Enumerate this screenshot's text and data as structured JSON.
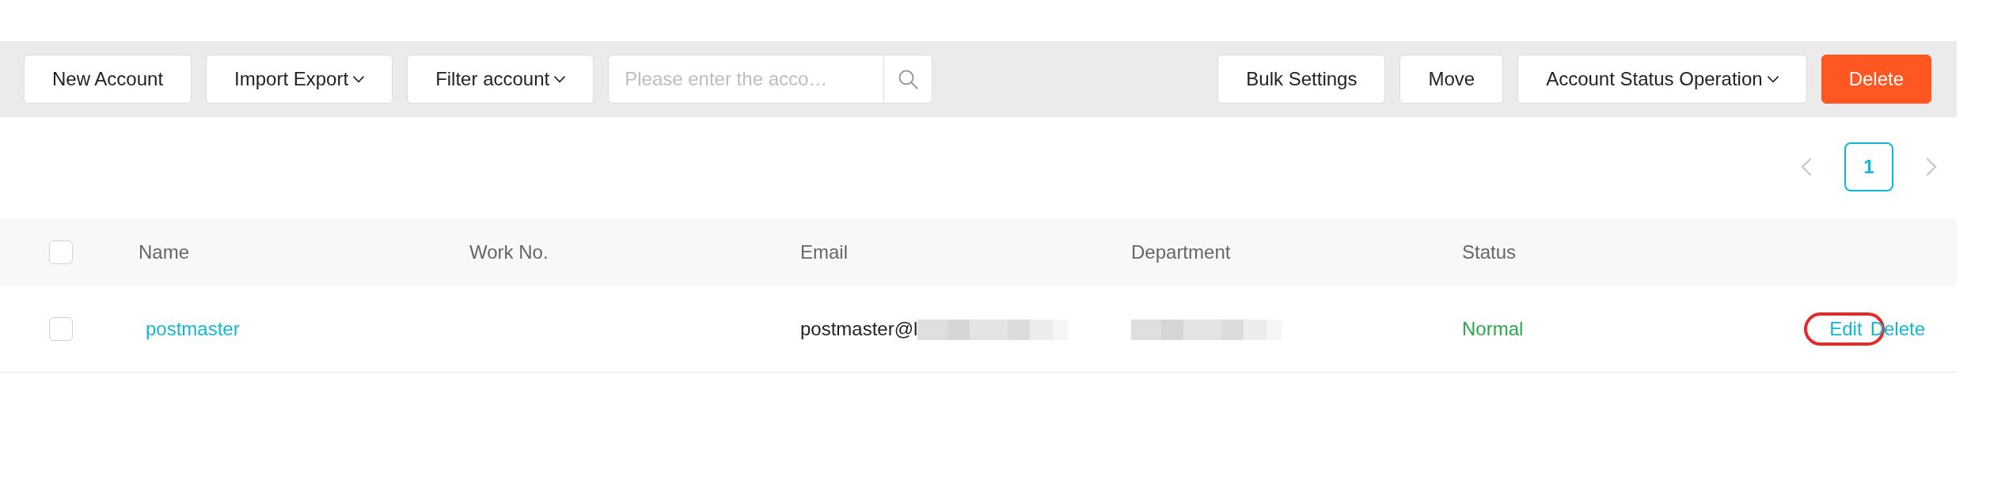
{
  "toolbar": {
    "left": [
      {
        "kind": "button",
        "label": "New Account",
        "dropdown": false
      },
      {
        "kind": "button",
        "label": "Import Export",
        "dropdown": true
      },
      {
        "kind": "button",
        "label": "Filter account",
        "dropdown": true
      },
      {
        "kind": "search",
        "placeholder": "Please enter the acco…"
      }
    ],
    "right": [
      {
        "kind": "button",
        "label": "Bulk Settings",
        "dropdown": false
      },
      {
        "kind": "button",
        "label": "Move",
        "dropdown": false
      },
      {
        "kind": "button",
        "label": "Account Status Operation",
        "dropdown": true
      },
      {
        "kind": "danger",
        "label": "Delete",
        "dropdown": false
      }
    ]
  },
  "pagination": {
    "pages": [
      {
        "label": "1",
        "selected": true
      }
    ]
  },
  "table": {
    "select_all": {
      "checked": false
    },
    "columns": [
      "Name",
      "Work No.",
      "Email",
      "Department",
      "Status"
    ],
    "rows": [
      {
        "selected": false,
        "name": "postmaster",
        "email": {
          "text": "postmaster@l",
          "redacted": true
        },
        "department": {
          "redacted": true
        },
        "status": {
          "text": "Normal",
          "kind": "normal"
        },
        "actions": [
          {
            "label": "Edit",
            "circled": true
          },
          {
            "label": "Delete",
            "circled": false
          }
        ]
      }
    ]
  }
}
